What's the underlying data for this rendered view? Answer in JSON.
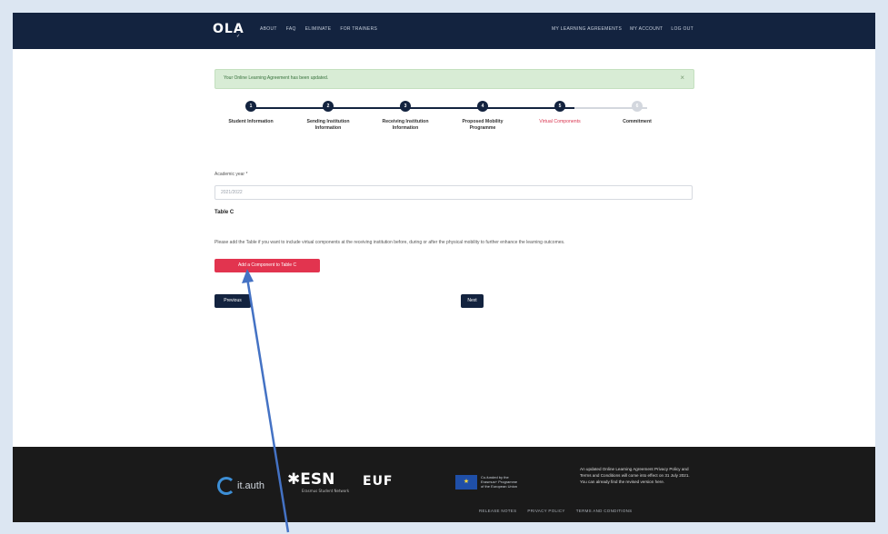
{
  "nav": {
    "logo": "OLA",
    "logo_sub": "✓",
    "links": [
      "About",
      "FAQ",
      "Eliminate",
      "For Trainers"
    ],
    "right_links": [
      "My Learning Agreements",
      "My Account",
      "Log out"
    ]
  },
  "alert": {
    "message": "Your Online Learning Agreement has been updated.",
    "close": "×"
  },
  "stepper": {
    "steps": [
      {
        "label_line1": "Student Information",
        "label_line2": "",
        "num": "1",
        "state": "done"
      },
      {
        "label_line1": "Sending Institution",
        "label_line2": "Information",
        "num": "2",
        "state": "done"
      },
      {
        "label_line1": "Receiving Institution",
        "label_line2": "Information",
        "num": "3",
        "state": "done"
      },
      {
        "label_line1": "Proposed Mobility",
        "label_line2": "Programme",
        "num": "4",
        "state": "done"
      },
      {
        "label_line1": "Virtual Components",
        "label_line2": "",
        "num": "5",
        "state": "active"
      },
      {
        "label_line1": "Commitment",
        "label_line2": "",
        "num": "6",
        "state": "pending"
      }
    ]
  },
  "form": {
    "field_label": "Academic year *",
    "field_placeholder": "2021/2022",
    "table_title": "Table C",
    "paragraph": "Please add the Table if you want to include virtual components at the receiving institution before, during or after the physical mobility to further enhance the learning outcomes.",
    "add_button": "Add a Component to Table C",
    "previous_button": "Previous",
    "next_button": "Next"
  },
  "footer": {
    "auth_logo": "it.auth",
    "esn_logo": "ESN",
    "esn_sub": "Erasmus Student Network",
    "euf_logo": "EUF",
    "eu_text": "Co-funded by the Erasmus+ Programme of the European Union",
    "note": "An updated Online Learning Agreement Privacy Policy and Terms and Conditions will come into effect on 31 July 2021. You can already find the revised version here.",
    "links": [
      "Release Notes",
      "Privacy Policy",
      "Terms and Conditions"
    ]
  },
  "annotation": {
    "arrow_color": "#4472c4"
  }
}
